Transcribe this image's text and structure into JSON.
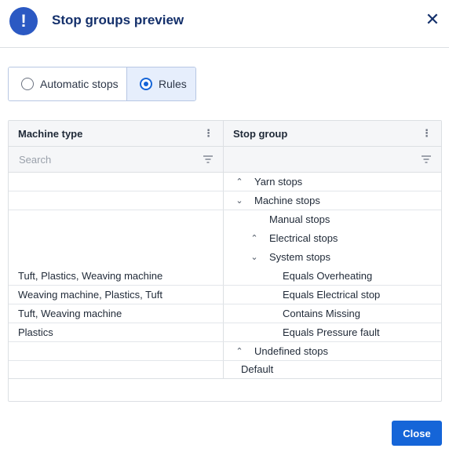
{
  "dialog": {
    "title": "Stop groups preview",
    "alert_icon": "exclamation-icon",
    "close_icon": "close-icon"
  },
  "mode_toggle": {
    "options": [
      {
        "label": "Automatic stops",
        "selected": false
      },
      {
        "label": "Rules",
        "selected": true
      }
    ]
  },
  "grid": {
    "columns": [
      {
        "label": "Machine type",
        "filter_placeholder": "Search"
      },
      {
        "label": "Stop group",
        "filter_placeholder": ""
      }
    ],
    "rows": [
      {
        "machine": "",
        "stop": "Yarn stops",
        "chevron": "up"
      },
      {
        "machine": "",
        "stop": "Machine stops",
        "chevron": "down"
      },
      {
        "machine": "",
        "stop": "Manual stops",
        "chevron": ""
      },
      {
        "machine": "",
        "stop": "Electrical stops",
        "chevron": "up"
      },
      {
        "machine": "Tuft, Plastics, Weaving machine",
        "stop": "System stops",
        "chevron": "down",
        "sub": "Equals Overheating"
      },
      {
        "machine": "Weaving machine, Plastics, Tuft",
        "stop": "Equals Electrical stop",
        "chevron": ""
      },
      {
        "machine": "Tuft, Weaving machine",
        "stop": "Contains Missing",
        "chevron": ""
      },
      {
        "machine": "Plastics",
        "stop": "Equals Pressure fault",
        "chevron": ""
      },
      {
        "machine": "",
        "stop": "Undefined stops",
        "chevron": "up"
      },
      {
        "machine": "",
        "stop": "Default",
        "chevron": ""
      }
    ]
  },
  "footer": {
    "close_label": "Close"
  },
  "colors": {
    "accent": "#1565d8",
    "title": "#14306b"
  }
}
